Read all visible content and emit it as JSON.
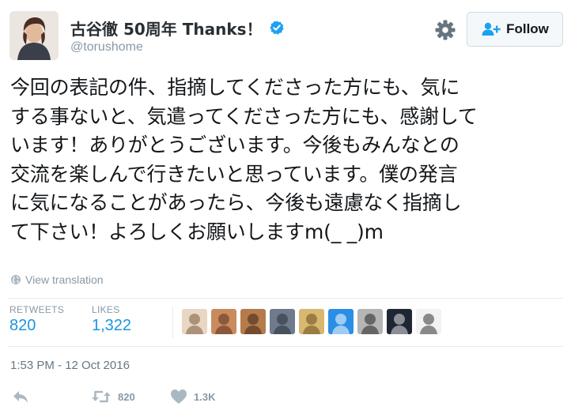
{
  "user": {
    "display_name": "古谷徹 50周年 Thanks！",
    "handle": "@torushome",
    "verified": true,
    "avatar_icon": "profile-photo"
  },
  "header": {
    "settings_icon": "gear-icon",
    "follow_label": "Follow",
    "follow_icon": "add-user-icon"
  },
  "tweet": {
    "lines": [
      "今回の表記の件、指摘してくださった方にも、気に",
      "する事ないと、気遣ってくださった方にも、感謝して",
      "います！ありがとうございます。今後もみんなとの",
      "交流を楽しんで行きたいと思っています。僕の発言",
      "に気になることがあったら、今後も遠慮なく指摘し",
      "て下さい！よろしくお願いしますm(_ _)m"
    ],
    "translate_label": "View translation",
    "timestamp": "1:53 PM - 12 Oct 2016"
  },
  "stats": {
    "retweets_label": "RETWEETS",
    "retweets_value": "820",
    "likes_label": "LIKES",
    "likes_value": "1,322"
  },
  "likers": [
    {
      "name": "liker-avatar-1",
      "bg": "#e8d7c4",
      "fg": "#7b5a3c"
    },
    {
      "name": "liker-avatar-2",
      "bg": "#c98b5e",
      "fg": "#5a2f1e"
    },
    {
      "name": "liker-avatar-3",
      "bg": "#b57b4a",
      "fg": "#3d2518"
    },
    {
      "name": "liker-avatar-4",
      "bg": "#6f7a8c",
      "fg": "#2a2f3a"
    },
    {
      "name": "liker-avatar-5",
      "bg": "#d8b870",
      "fg": "#6b4d1c"
    },
    {
      "name": "liker-avatar-6",
      "bg": "#2b8ee6",
      "fg": "#ffffff"
    },
    {
      "name": "liker-avatar-7",
      "bg": "#b5b5b5",
      "fg": "#222222"
    },
    {
      "name": "liker-avatar-8",
      "bg": "#1f2633",
      "fg": "#e6e6e6"
    },
    {
      "name": "liker-avatar-9",
      "bg": "#f2f2f2",
      "fg": "#333333"
    }
  ],
  "actions": {
    "reply_icon": "reply-icon",
    "retweet_icon": "retweet-icon",
    "retweet_count": "820",
    "like_icon": "heart-icon",
    "like_count": "1.3K"
  },
  "colors": {
    "accent": "#1b95e0",
    "muted": "#8899a6",
    "verified": "#1da1f2"
  }
}
